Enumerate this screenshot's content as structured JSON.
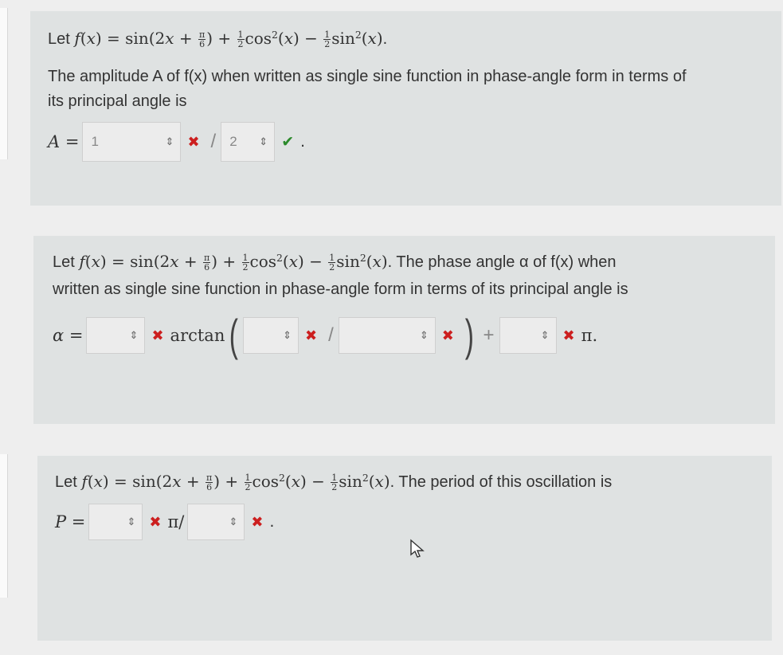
{
  "common": {
    "let": "Let",
    "fx": "f(x) =",
    "sin": "sin",
    "cos": "cos",
    "x_arg": "(x)",
    "two_x": "(2x +",
    "pi": "π",
    "six": "6",
    "one": "1",
    "two": "2",
    "rpar": ")",
    "plus": "+",
    "minus": "−",
    "period_dot": "."
  },
  "q1": {
    "intro_end": ".",
    "text_line1": "The amplitude A of f(x) when written as single sine function in phase-angle form in terms of",
    "text_line2": "its principal angle is",
    "label": "A =",
    "box1_value": "1",
    "box2_value": "2",
    "end": "."
  },
  "q2": {
    "text_line1_rest": ". The phase angle α of f(x) when",
    "text_line2": "written as single sine function in phase-angle form in terms of its principal angle is",
    "label": "α =",
    "arctan": "arctan",
    "pi_end": "π."
  },
  "q3": {
    "text_rest": ". The period of this oscillation is",
    "label": "P =",
    "pi_slash": "π/",
    "end": "."
  },
  "icons": {
    "spinner": "⇕",
    "cross": "✖",
    "check": "✔",
    "slash": "/"
  }
}
